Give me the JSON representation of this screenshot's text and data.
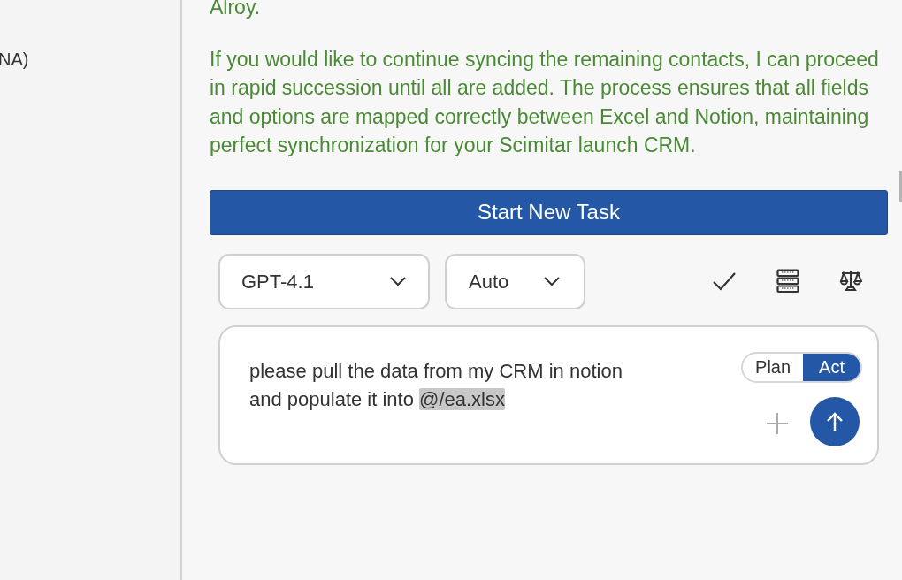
{
  "sidebar": {
    "text": "NA)"
  },
  "messages": [
    "Alroy.",
    "If you would like to continue syncing the remaining contacts, I can proceed in rapid succession until all are added. The process ensures that all fields and options are mapped correctly between Excel and Notion, maintaining perfect synchronization for your Scimitar launch CRM."
  ],
  "start_button": "Start New Task",
  "model_select": {
    "value": "GPT-4.1"
  },
  "mode_select": {
    "value": "Auto"
  },
  "toolbar": [
    {
      "kind": "check"
    },
    {
      "kind": "server"
    },
    {
      "kind": "scale"
    }
  ],
  "prompt": {
    "text": "please pull the data from my CRM in notion and populate it into ",
    "mention": "@/ea.xlsx"
  },
  "mode_toggle": [
    {
      "label": "Plan",
      "selected": false
    },
    {
      "label": "Act",
      "selected": true
    }
  ]
}
